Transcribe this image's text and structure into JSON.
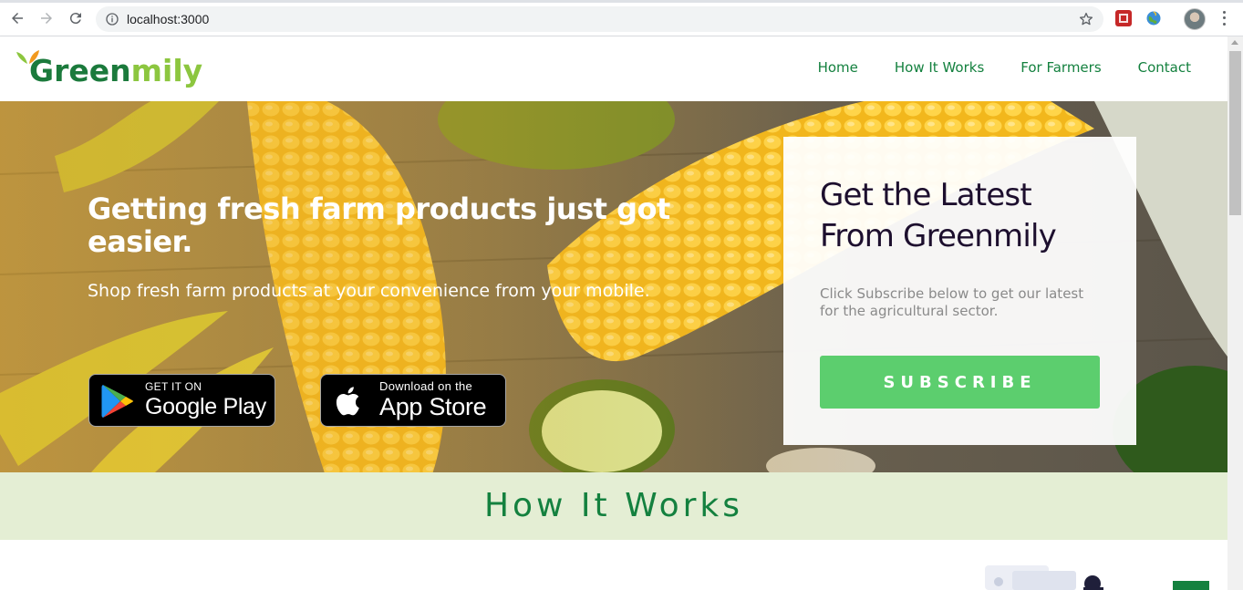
{
  "browser": {
    "url": "localhost:3000"
  },
  "header": {
    "logo": {
      "part1": "Green",
      "part2": "mily"
    },
    "nav": [
      "Home",
      "How It Works",
      "For Farmers",
      "Contact"
    ]
  },
  "hero": {
    "title": "Getting fresh farm products just got easier.",
    "subtitle": "Shop fresh farm products at your convenience from your mobile.",
    "google_badge": {
      "small": "GET IT ON",
      "big": "Google Play"
    },
    "apple_badge": {
      "small": "Download on the",
      "big": "App Store"
    }
  },
  "subscribe_card": {
    "title": "Get the Latest From Greenmily",
    "text": "Click Subscribe below to get our latest for the agricultural sector.",
    "button": "SUBSCRIBE"
  },
  "how_it_works": {
    "title": "How It Works"
  },
  "colors": {
    "brand_green": "#14813f",
    "light_green": "#8cc63f",
    "subscribe_green": "#5cce6e",
    "band_bg": "#e4eed4"
  }
}
